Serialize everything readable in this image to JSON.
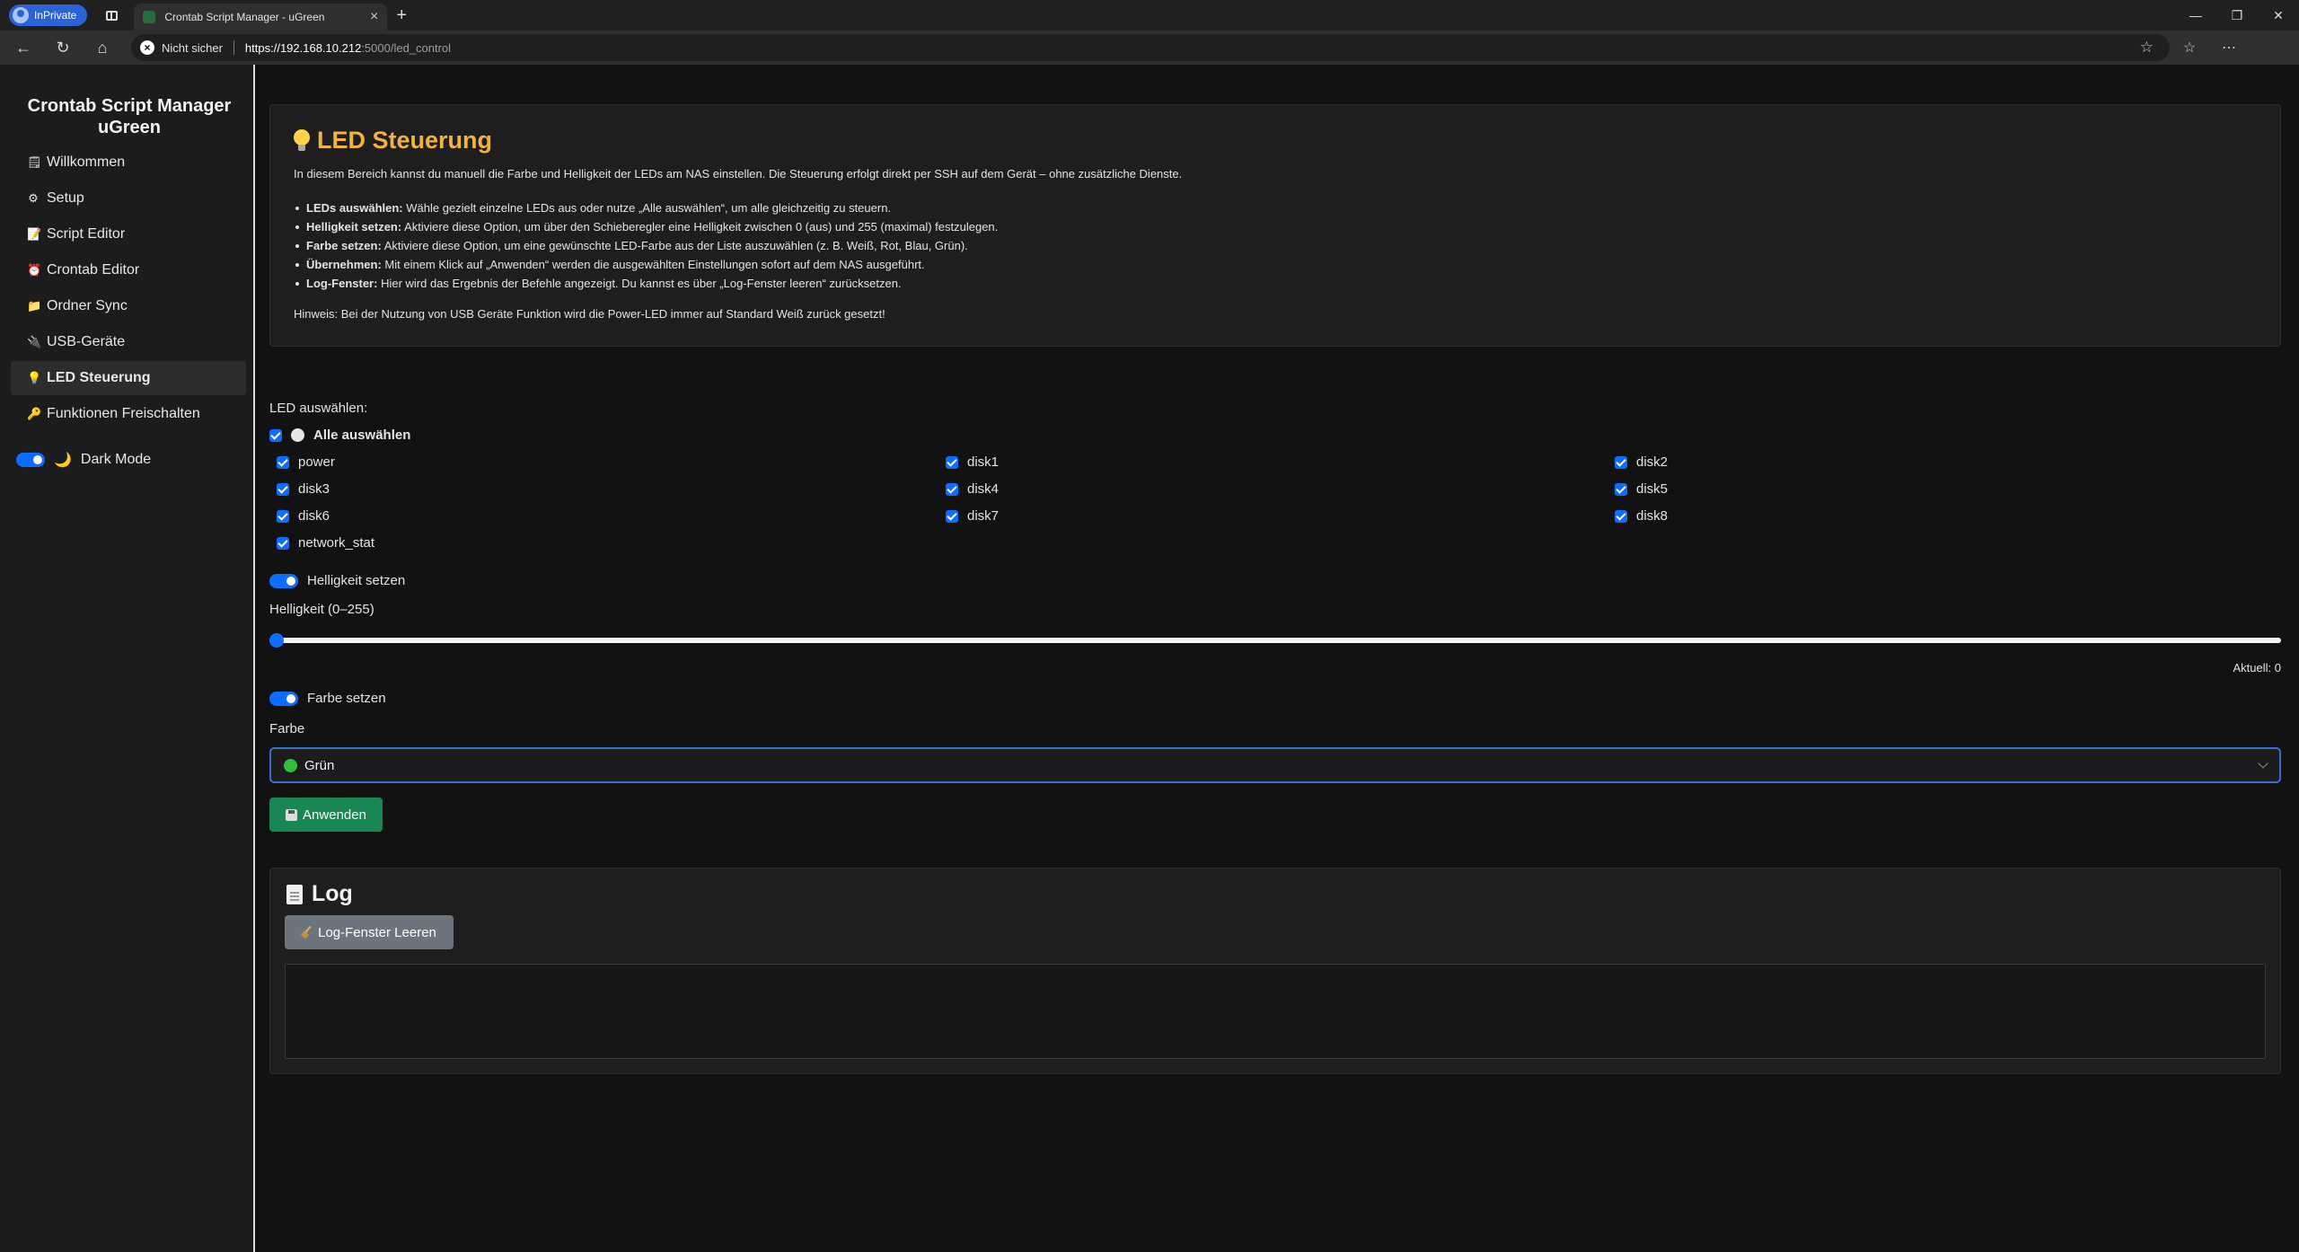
{
  "browser": {
    "inprivate_label": "InPrivate",
    "tab_title": "Crontab Script Manager - uGreen",
    "security_label": "Nicht sicher",
    "url_scheme_host": "https://192.168.10.212",
    "url_path": ":5000/led_control"
  },
  "sidebar": {
    "brand": "Crontab Script Manager uGreen",
    "items": [
      {
        "icon": "document-icon",
        "label": "Willkommen"
      },
      {
        "icon": "gear-icon",
        "label": "Setup"
      },
      {
        "icon": "script-icon",
        "label": "Script Editor"
      },
      {
        "icon": "alarm-clock-icon",
        "label": "Crontab Editor"
      },
      {
        "icon": "folder-icon",
        "label": "Ordner Sync"
      },
      {
        "icon": "usb-icon",
        "label": "USB-Geräte"
      },
      {
        "icon": "bulb-icon",
        "label": "LED Steuerung"
      },
      {
        "icon": "key-icon",
        "label": "Funktionen Freischalten"
      }
    ],
    "dark_mode_label": "Dark Mode",
    "dark_mode_on": true
  },
  "info": {
    "title": "LED Steuerung",
    "intro": "In diesem Bereich kannst du manuell die Farbe und Helligkeit der LEDs am NAS einstellen. Die Steuerung erfolgt direkt per SSH auf dem Gerät – ohne zusätzliche Dienste.",
    "bullets": [
      {
        "term": "LEDs auswählen:",
        "text": " Wähle gezielt einzelne LEDs aus oder nutze „Alle auswählen“, um alle gleichzeitig zu steuern."
      },
      {
        "term": "Helligkeit setzen:",
        "text": " Aktiviere diese Option, um über den Schieberegler eine Helligkeit zwischen 0 (aus) und 255 (maximal) festzulegen."
      },
      {
        "term": "Farbe setzen:",
        "text": " Aktiviere diese Option, um eine gewünschte LED-Farbe aus der Liste auszuwählen (z. B. Weiß, Rot, Blau, Grün)."
      },
      {
        "term": "Übernehmen:",
        "text": " Mit einem Klick auf „Anwenden“ werden die ausgewählten Einstellungen sofort auf dem NAS ausgeführt."
      },
      {
        "term": "Log-Fenster:",
        "text": " Hier wird das Ergebnis der Befehle angezeigt. Du kannst es über „Log-Fenster leeren“ zurücksetzen."
      }
    ],
    "hint": "Hinweis: Bei der Nutzung von USB Geräte Funktion wird die Power-LED immer auf Standard Weiß zurück gesetzt!"
  },
  "led": {
    "select_label": "LED auswählen:",
    "select_all_label": "Alle auswählen",
    "leds": [
      "power",
      "disk1",
      "disk2",
      "disk3",
      "disk4",
      "disk5",
      "disk6",
      "disk7",
      "disk8",
      "network_stat"
    ],
    "all_checked": true
  },
  "brightness": {
    "toggle_label": "Helligkeit setzen",
    "enabled": true,
    "range_label": "Helligkeit (0–255)",
    "value": 0,
    "min": 0,
    "max": 255,
    "current_label": "Aktuell: 0"
  },
  "color": {
    "toggle_label": "Farbe setzen",
    "enabled": true,
    "field_label": "Farbe",
    "selected": "Grün",
    "selected_color": "#2fbf3a"
  },
  "apply_label": "Anwenden",
  "log": {
    "title": "Log",
    "clear_label": "Log-Fenster Leeren",
    "content": ""
  },
  "colors": {
    "accent": "#0d6efd",
    "title": "#f0b43c",
    "apply_button": "#198754",
    "clear_button": "#6c757d"
  }
}
